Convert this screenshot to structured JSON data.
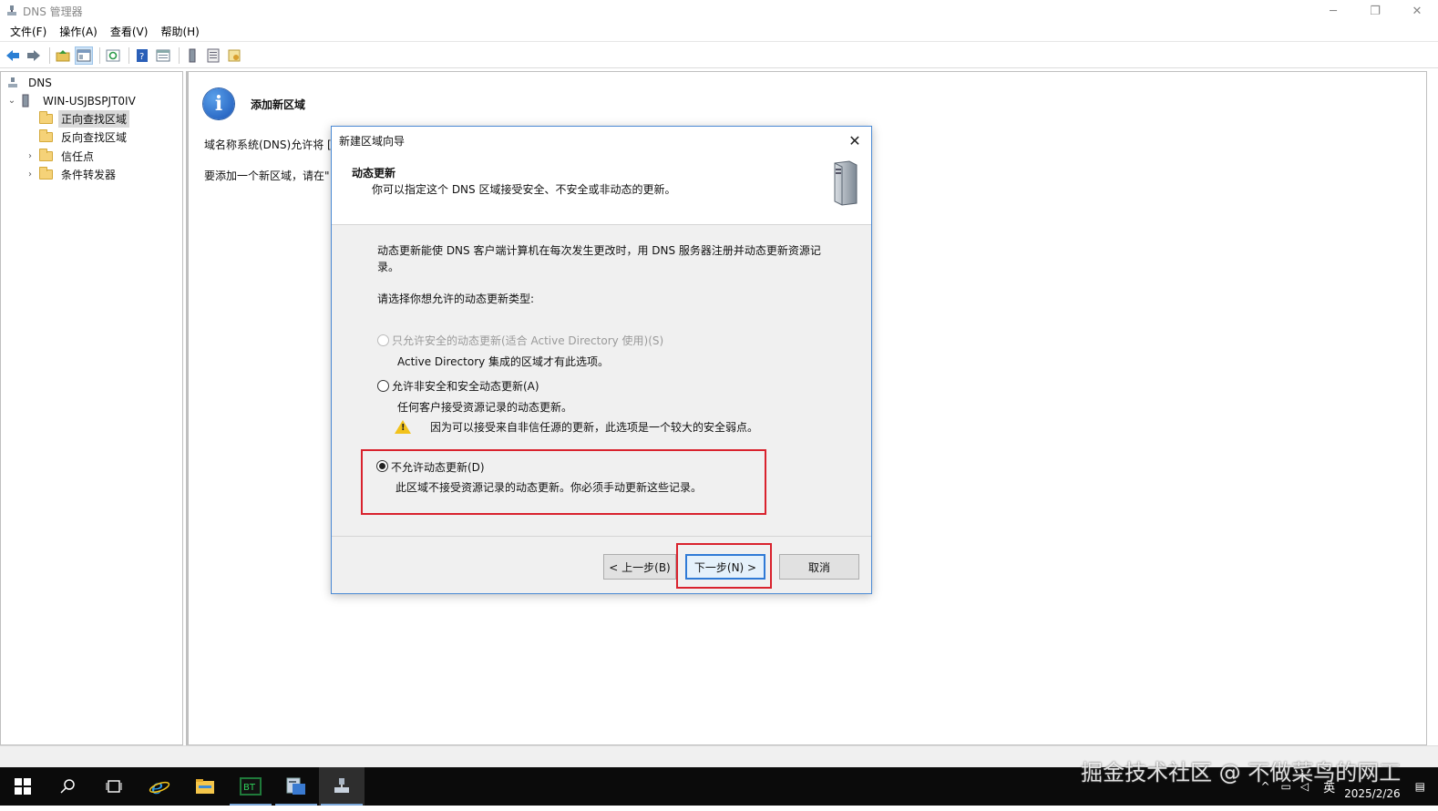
{
  "window": {
    "title": "DNS 管理器",
    "controls": {
      "minimize": "─",
      "restore": "❐",
      "close": "✕"
    }
  },
  "menu": [
    "文件(F)",
    "操作(A)",
    "查看(V)",
    "帮助(H)"
  ],
  "toolbar": {
    "icons": [
      "back-icon",
      "forward-icon",
      "up-folder-icon",
      "show-tree-icon",
      "refresh-icon",
      "help-icon",
      "console-icon",
      "server-icon",
      "list-icon",
      "properties-icon"
    ]
  },
  "tree": {
    "root": "DNS",
    "server": "WIN-USJBSPJT0IV",
    "items": [
      {
        "label": "正向查找区域",
        "selected": true
      },
      {
        "label": "反向查找区域",
        "selected": false
      },
      {
        "label": "信任点",
        "selected": false
      },
      {
        "label": "条件转发器",
        "selected": false
      }
    ]
  },
  "right_pane": {
    "title": "添加新区域",
    "text1": "域名称系统(DNS)允许将 [",
    "text2": "要添加一个新区域，请在\""
  },
  "dialog": {
    "title": "新建区域向导",
    "close": "✕",
    "header_title": "动态更新",
    "header_subtitle": "你可以指定这个 DNS 区域接受安全、不安全或非动态的更新。",
    "intro_line1": "动态更新能使 DNS 客户端计算机在每次发生更改时，用 DNS 服务器注册并动态更新资源记",
    "intro_line2": "录。",
    "prompt": "请选择你想允许的动态更新类型:",
    "options": [
      {
        "label": "只允许安全的动态更新(适合 Active Directory 使用)(S)",
        "desc": "Active Directory 集成的区域才有此选项。",
        "enabled": false,
        "checked": false
      },
      {
        "label": "允许非安全和安全动态更新(A)",
        "desc": "任何客户接受资源记录的动态更新。",
        "warning": "因为可以接受来自非信任源的更新，此选项是一个较大的安全弱点。",
        "enabled": true,
        "checked": false
      },
      {
        "label": "不允许动态更新(D)",
        "desc": "此区域不接受资源记录的动态更新。你必须手动更新这些记录。",
        "enabled": true,
        "checked": true
      }
    ],
    "buttons": {
      "back": "< 上一步(B)",
      "next": "下一步(N) >",
      "cancel": "取消"
    }
  },
  "taskbar": {
    "items": [
      "start-icon",
      "search-icon",
      "task-view-icon",
      "ie-icon",
      "file-explorer-icon",
      "bt-panel-icon",
      "server-manager-icon",
      "dns-manager-icon"
    ],
    "language": "英",
    "date": "2025/2/26"
  },
  "watermark": "掘金技术社区 @ 不做菜鸟的网工",
  "colors": {
    "highlight_red": "#d9222d",
    "accent_blue": "#2f7ad6"
  }
}
